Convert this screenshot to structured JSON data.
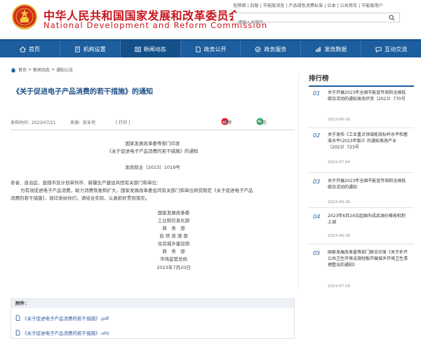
{
  "header": {
    "cn_title": "中华人民共和国国家发展和改革委员会",
    "en_title": "National Development and Reform Commission",
    "top_links": "无障碍 | 旧版 | 节能版浏览 | 产品绿色消费标准 | 日本 | 公共用车 | 节能版用户",
    "search_placeholder": "请输入关键字"
  },
  "nav": [
    {
      "label": "首页",
      "icon": "home-icon"
    },
    {
      "label": "机构设置",
      "icon": "building-icon"
    },
    {
      "label": "新闻动态",
      "icon": "news-icon"
    },
    {
      "label": "政务公开",
      "icon": "document-icon"
    },
    {
      "label": "政务服务",
      "icon": "service-icon"
    },
    {
      "label": "发改数据",
      "icon": "data-icon"
    },
    {
      "label": "互动交流",
      "icon": "chat-icon"
    }
  ],
  "breadcrumb": {
    "items": [
      "首页",
      "新闻动态",
      "通知公告"
    ],
    "separator": ">"
  },
  "article": {
    "title": "《关于促进电子产品消费的若干措施》的通知",
    "date": "发布时间：2023/07/21",
    "source": "来源：就业司",
    "print": "[ 打印 ]",
    "share_weibo": "微博",
    "share_wechat": "微信",
    "forward_line1": "国家发展改革委等部门印发",
    "forward_line2": "《关于促进电子产品消费的若干措施》的通知",
    "doc_number": "发改就业〔2023〕1019号",
    "recipients": "各省、自治区、直辖市及计划单列市、新疆生产建设兵团有关部门和单位：",
    "body_line1": "为有效促进电子产品消费，助力消费恢复和扩大，国家发展改革委会同有关部门和单位研究制定《关于促进电子产品",
    "body_line2": "消费的若干措施》，现印发给你们，请结合实际，认真抓好贯彻落实。",
    "signatures": [
      "国家发展改革委",
      "工业和信息化部",
      "商　务　部",
      "自 然 资 源 部",
      "住房城乡建设部",
      "商　务　部",
      "市场监管总局"
    ],
    "sign_date": "2023年7月20日"
  },
  "attachments": {
    "heading": "附件：",
    "items": [
      "《关于促进电子产品消费的若干措施》.pdf",
      "《关于促进电子产品消费的若干措施》.ofd"
    ]
  },
  "sidebar": {
    "title": "排行榜",
    "items": [
      {
        "num": "01",
        "text": "关于开展2023年全国节能宣传周和全国低碳日活动的通知发改环资〔2023〕770号",
        "date": "2023-06-26"
      },
      {
        "num": "02",
        "text": "关于发布《工业重点领域能效标杆水平和基准水平(2023年版)》的通知发改产业〔2023〕723号",
        "date": "2023-07-04"
      },
      {
        "num": "03",
        "text": "关于开展2023年全国节能宣传周和全国低碳日活动的通知",
        "date": "2023-06-26"
      },
      {
        "num": "04",
        "text": "2023年6月24日起国内成品油价格按机制上调",
        "date": "2023-06-28"
      },
      {
        "num": "05",
        "text": "国家发展改革委等部门联合印发《关于补齐公共卫生环境设施短板开展城乡环境卫生清理整治的通知》",
        "date": "2023-07-18"
      }
    ]
  },
  "colors": {
    "brand_red": "#c8161d",
    "nav_blue": "#1c5e9e",
    "title_blue": "#1e4f87"
  }
}
